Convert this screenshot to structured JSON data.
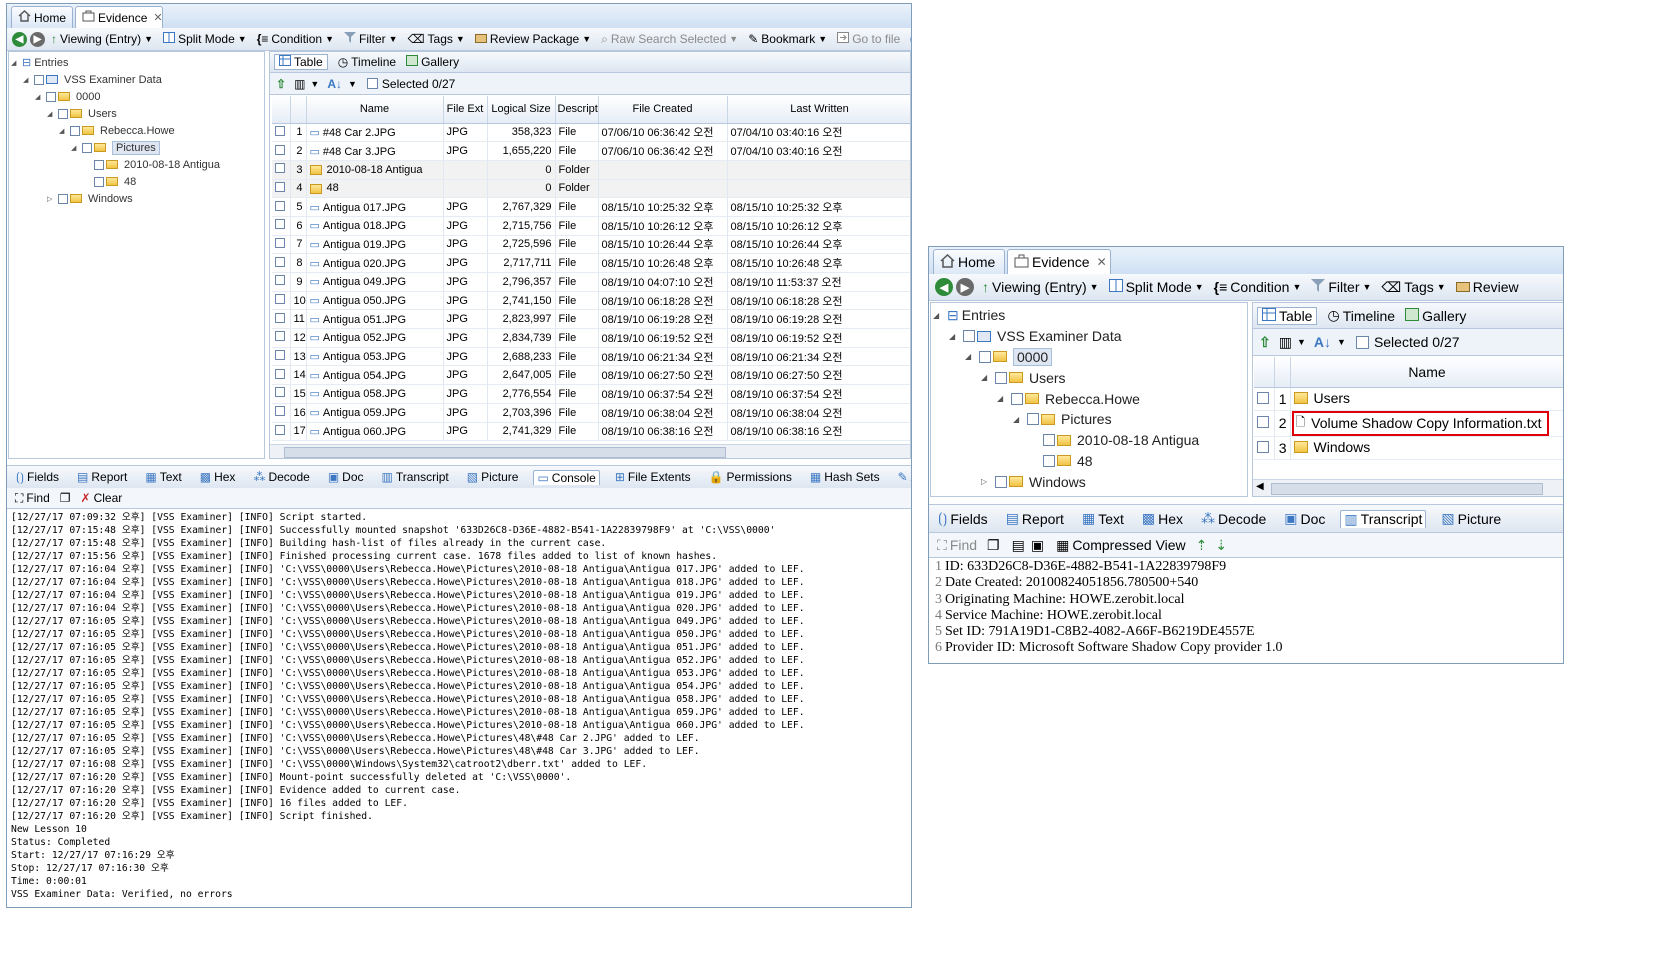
{
  "left": {
    "tabs": [
      {
        "label": "Home"
      },
      {
        "label": "Evidence"
      }
    ],
    "toolbar": {
      "viewing": "Viewing (Entry)",
      "split_mode": "Split Mode",
      "condition": "Condition",
      "filter": "Filter",
      "tags": "Tags",
      "review_package": "Review Package",
      "raw_search": "Raw Search Selected",
      "bookmark": "Bookmark",
      "go_to_file": "Go to file"
    },
    "tree": [
      {
        "label": "Entries",
        "level": 0
      },
      {
        "label": "VSS Examiner Data",
        "level": 1
      },
      {
        "label": "0000",
        "level": 2
      },
      {
        "label": "Users",
        "level": 3
      },
      {
        "label": "Rebecca.Howe",
        "level": 4
      },
      {
        "label": "Pictures",
        "level": 5,
        "selected": true
      },
      {
        "label": "2010-08-18 Antigua",
        "level": 6
      },
      {
        "label": "48",
        "level": 6
      },
      {
        "label": "Windows",
        "level": 3
      }
    ],
    "view_tabs": {
      "table": "Table",
      "timeline": "Timeline",
      "gallery": "Gallery"
    },
    "selected": "Selected 0/27",
    "columns": [
      "Name",
      "File Ext",
      "Logical Size",
      "Descript",
      "File Created",
      "Last Written"
    ],
    "rows": [
      {
        "num": "1",
        "name": "#48 Car 2.JPG",
        "ext": "JPG",
        "size": "358,323",
        "desc": "File",
        "created": "07/06/10 06:36:42 오전",
        "written": "07/04/10 03:40:16 오전"
      },
      {
        "num": "2",
        "name": "#48 Car 3.JPG",
        "ext": "JPG",
        "size": "1,655,220",
        "desc": "File",
        "created": "07/06/10 06:36:42 오전",
        "written": "07/04/10 03:40:16 오전"
      },
      {
        "num": "3",
        "name": "2010-08-18 Antigua",
        "ext": "",
        "size": "0",
        "desc": "Folder",
        "created": "",
        "written": "",
        "folder": true
      },
      {
        "num": "4",
        "name": "48",
        "ext": "",
        "size": "0",
        "desc": "Folder",
        "created": "",
        "written": "",
        "folder": true
      },
      {
        "num": "5",
        "name": "Antigua 017.JPG",
        "ext": "JPG",
        "size": "2,767,329",
        "desc": "File",
        "created": "08/15/10 10:25:32 오후",
        "written": "08/15/10 10:25:32 오후"
      },
      {
        "num": "6",
        "name": "Antigua 018.JPG",
        "ext": "JPG",
        "size": "2,715,756",
        "desc": "File",
        "created": "08/15/10 10:26:12 오후",
        "written": "08/15/10 10:26:12 오후"
      },
      {
        "num": "7",
        "name": "Antigua 019.JPG",
        "ext": "JPG",
        "size": "2,725,596",
        "desc": "File",
        "created": "08/15/10 10:26:44 오후",
        "written": "08/15/10 10:26:44 오후"
      },
      {
        "num": "8",
        "name": "Antigua 020.JPG",
        "ext": "JPG",
        "size": "2,717,711",
        "desc": "File",
        "created": "08/15/10 10:26:48 오후",
        "written": "08/15/10 10:26:48 오후"
      },
      {
        "num": "9",
        "name": "Antigua 049.JPG",
        "ext": "JPG",
        "size": "2,796,357",
        "desc": "File",
        "created": "08/19/10 04:07:10 오전",
        "written": "08/19/10 11:53:37 오전"
      },
      {
        "num": "10",
        "name": "Antigua 050.JPG",
        "ext": "JPG",
        "size": "2,741,150",
        "desc": "File",
        "created": "08/19/10 06:18:28 오전",
        "written": "08/19/10 06:18:28 오전"
      },
      {
        "num": "11",
        "name": "Antigua 051.JPG",
        "ext": "JPG",
        "size": "2,823,997",
        "desc": "File",
        "created": "08/19/10 06:19:28 오전",
        "written": "08/19/10 06:19:28 오전"
      },
      {
        "num": "12",
        "name": "Antigua 052.JPG",
        "ext": "JPG",
        "size": "2,834,739",
        "desc": "File",
        "created": "08/19/10 06:19:52 오전",
        "written": "08/19/10 06:19:52 오전"
      },
      {
        "num": "13",
        "name": "Antigua 053.JPG",
        "ext": "JPG",
        "size": "2,688,233",
        "desc": "File",
        "created": "08/19/10 06:21:34 오전",
        "written": "08/19/10 06:21:34 오전"
      },
      {
        "num": "14",
        "name": "Antigua 054.JPG",
        "ext": "JPG",
        "size": "2,647,005",
        "desc": "File",
        "created": "08/19/10 06:27:50 오전",
        "written": "08/19/10 06:27:50 오전"
      },
      {
        "num": "15",
        "name": "Antigua 058.JPG",
        "ext": "JPG",
        "size": "2,776,554",
        "desc": "File",
        "created": "08/19/10 06:37:54 오전",
        "written": "08/19/10 06:37:54 오전"
      },
      {
        "num": "16",
        "name": "Antigua 059.JPG",
        "ext": "JPG",
        "size": "2,703,396",
        "desc": "File",
        "created": "08/19/10 06:38:04 오전",
        "written": "08/19/10 06:38:04 오전"
      },
      {
        "num": "17",
        "name": "Antigua 060.JPG",
        "ext": "JPG",
        "size": "2,741,329",
        "desc": "File",
        "created": "08/19/10 06:38:16 오전",
        "written": "08/19/10 06:38:16 오전"
      }
    ],
    "bottom_tabs": [
      "Fields",
      "Report",
      "Text",
      "Hex",
      "Decode",
      "Doc",
      "Transcript",
      "Picture",
      "Console",
      "File Extents",
      "Permissions",
      "Hash Sets",
      "Attributes"
    ],
    "find_label": "Find",
    "clear_label": "Clear",
    "console_lines": [
      "[12/27/17 07:09:32 오후] [VSS Examiner] [INFO] Script started.",
      "[12/27/17 07:15:48 오후] [VSS Examiner] [INFO] Successfully mounted snapshot '633D26C8-D36E-4882-B541-1A22839798F9' at 'C:\\VSS\\0000'",
      "[12/27/17 07:15:48 오후] [VSS Examiner] [INFO] Building hash-list of files already in the current case.",
      "[12/27/17 07:15:56 오후] [VSS Examiner] [INFO] Finished processing current case. 1678 files added to list of known hashes.",
      "[12/27/17 07:16:04 오후] [VSS Examiner] [INFO] 'C:\\VSS\\0000\\Users\\Rebecca.Howe\\Pictures\\2010-08-18 Antigua\\Antigua 017.JPG' added to LEF.",
      "[12/27/17 07:16:04 오후] [VSS Examiner] [INFO] 'C:\\VSS\\0000\\Users\\Rebecca.Howe\\Pictures\\2010-08-18 Antigua\\Antigua 018.JPG' added to LEF.",
      "[12/27/17 07:16:04 오후] [VSS Examiner] [INFO] 'C:\\VSS\\0000\\Users\\Rebecca.Howe\\Pictures\\2010-08-18 Antigua\\Antigua 019.JPG' added to LEF.",
      "[12/27/17 07:16:04 오후] [VSS Examiner] [INFO] 'C:\\VSS\\0000\\Users\\Rebecca.Howe\\Pictures\\2010-08-18 Antigua\\Antigua 020.JPG' added to LEF.",
      "[12/27/17 07:16:05 오후] [VSS Examiner] [INFO] 'C:\\VSS\\0000\\Users\\Rebecca.Howe\\Pictures\\2010-08-18 Antigua\\Antigua 049.JPG' added to LEF.",
      "[12/27/17 07:16:05 오후] [VSS Examiner] [INFO] 'C:\\VSS\\0000\\Users\\Rebecca.Howe\\Pictures\\2010-08-18 Antigua\\Antigua 050.JPG' added to LEF.",
      "[12/27/17 07:16:05 오후] [VSS Examiner] [INFO] 'C:\\VSS\\0000\\Users\\Rebecca.Howe\\Pictures\\2010-08-18 Antigua\\Antigua 051.JPG' added to LEF.",
      "[12/27/17 07:16:05 오후] [VSS Examiner] [INFO] 'C:\\VSS\\0000\\Users\\Rebecca.Howe\\Pictures\\2010-08-18 Antigua\\Antigua 052.JPG' added to LEF.",
      "[12/27/17 07:16:05 오후] [VSS Examiner] [INFO] 'C:\\VSS\\0000\\Users\\Rebecca.Howe\\Pictures\\2010-08-18 Antigua\\Antigua 053.JPG' added to LEF.",
      "[12/27/17 07:16:05 오후] [VSS Examiner] [INFO] 'C:\\VSS\\0000\\Users\\Rebecca.Howe\\Pictures\\2010-08-18 Antigua\\Antigua 054.JPG' added to LEF.",
      "[12/27/17 07:16:05 오후] [VSS Examiner] [INFO] 'C:\\VSS\\0000\\Users\\Rebecca.Howe\\Pictures\\2010-08-18 Antigua\\Antigua 058.JPG' added to LEF.",
      "[12/27/17 07:16:05 오후] [VSS Examiner] [INFO] 'C:\\VSS\\0000\\Users\\Rebecca.Howe\\Pictures\\2010-08-18 Antigua\\Antigua 059.JPG' added to LEF.",
      "[12/27/17 07:16:05 오후] [VSS Examiner] [INFO] 'C:\\VSS\\0000\\Users\\Rebecca.Howe\\Pictures\\2010-08-18 Antigua\\Antigua 060.JPG' added to LEF.",
      "[12/27/17 07:16:05 오후] [VSS Examiner] [INFO] 'C:\\VSS\\0000\\Users\\Rebecca.Howe\\Pictures\\48\\#48 Car 2.JPG' added to LEF.",
      "[12/27/17 07:16:05 오후] [VSS Examiner] [INFO] 'C:\\VSS\\0000\\Users\\Rebecca.Howe\\Pictures\\48\\#48 Car 3.JPG' added to LEF.",
      "[12/27/17 07:16:08 오후] [VSS Examiner] [INFO] 'C:\\VSS\\0000\\Windows\\System32\\catroot2\\dberr.txt' added to LEF.",
      "[12/27/17 07:16:20 오후] [VSS Examiner] [INFO] Mount-point successfully deleted at 'C:\\VSS\\0000'.",
      "[12/27/17 07:16:20 오후] [VSS Examiner] [INFO] Evidence added to current case.",
      "[12/27/17 07:16:20 오후] [VSS Examiner] [INFO] 16 files added to LEF.",
      "[12/27/17 07:16:20 오후] [VSS Examiner] [INFO] Script finished.",
      "New Lesson 10",
      "Status: Completed",
      "Start: 12/27/17 07:16:29 오후",
      "Stop: 12/27/17 07:16:30 오후",
      "Time: 0:00:01",
      "VSS Examiner Data: Verified, no errors"
    ]
  },
  "right": {
    "tabs": [
      {
        "label": "Home"
      },
      {
        "label": "Evidence"
      }
    ],
    "toolbar": {
      "viewing": "Viewing (Entry)",
      "split_mode": "Split Mode",
      "condition": "Condition",
      "filter": "Filter",
      "tags": "Tags",
      "review": "Review"
    },
    "tree": [
      {
        "label": "Entries",
        "level": 0
      },
      {
        "label": "VSS Examiner Data",
        "level": 1
      },
      {
        "label": "0000",
        "level": 2,
        "selected": true
      },
      {
        "label": "Users",
        "level": 3
      },
      {
        "label": "Rebecca.Howe",
        "level": 4
      },
      {
        "label": "Pictures",
        "level": 5
      },
      {
        "label": "2010-08-18 Antigua",
        "level": 6
      },
      {
        "label": "48",
        "level": 6
      },
      {
        "label": "Windows",
        "level": 3
      }
    ],
    "view_tabs": {
      "table": "Table",
      "timeline": "Timeline",
      "gallery": "Gallery"
    },
    "selected": "Selected 0/27",
    "column_name": "Name",
    "rows": [
      {
        "num": "1",
        "name": "Users",
        "folder": true
      },
      {
        "num": "2",
        "name": "Volume Shadow Copy Information.txt",
        "folder": false,
        "highlight": true
      },
      {
        "num": "3",
        "name": "Windows",
        "folder": true
      }
    ],
    "bottom_tabs": [
      "Fields",
      "Report",
      "Text",
      "Hex",
      "Decode",
      "Doc",
      "Transcript",
      "Picture"
    ],
    "find_label": "Find",
    "compressed_view": "Compressed View",
    "transcript_lines": [
      {
        "num": "1",
        "text": "ID: 633D26C8-D36E-4882-B541-1A22839798F9"
      },
      {
        "num": "2",
        "text": "Date Created: 20100824051856.780500+540"
      },
      {
        "num": "3",
        "text": "Originating Machine: HOWE.zerobit.local"
      },
      {
        "num": "4",
        "text": "Service Machine: HOWE.zerobit.local"
      },
      {
        "num": "5",
        "text": "Set ID: 791A19D1-C8B2-4082-A66F-B6219DE4557E"
      },
      {
        "num": "6",
        "text": "Provider ID: Microsoft Software Shadow Copy provider 1.0"
      }
    ]
  },
  "colors": {
    "highlight_box": "#e0000c",
    "accent": "#3b77c2",
    "toolbar_bg": "#dde6f1"
  }
}
